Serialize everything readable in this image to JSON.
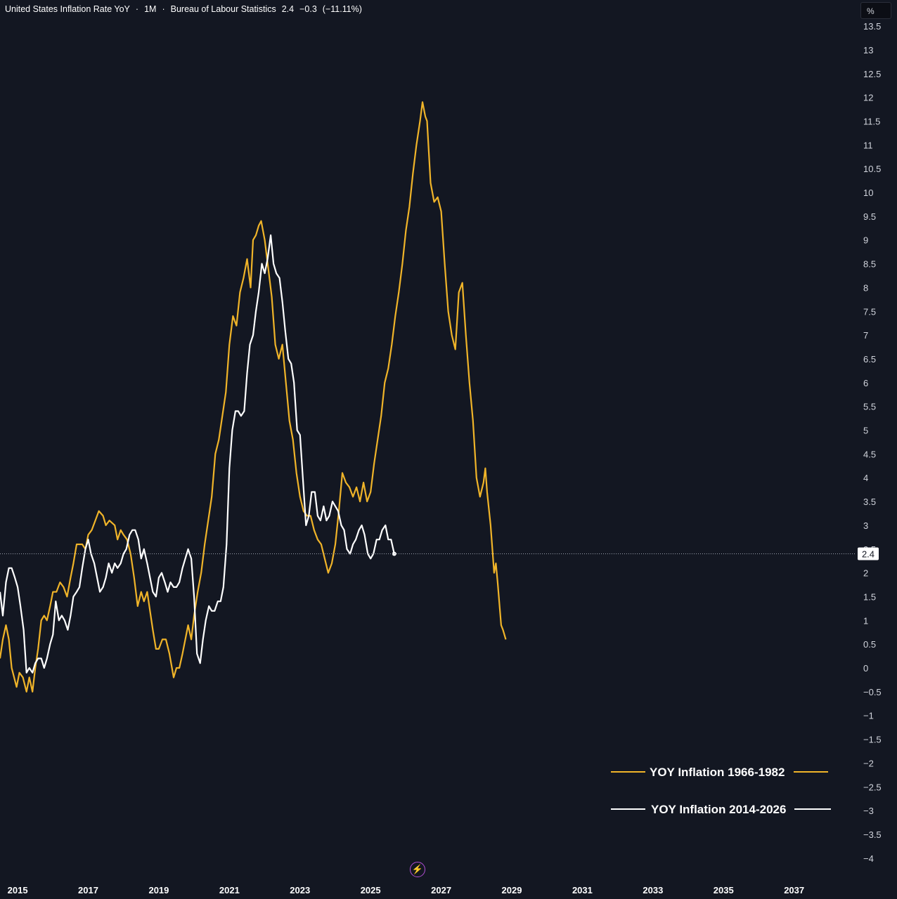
{
  "header": {
    "symbol_title": "United States Inflation Rate YoY",
    "interval": "1M",
    "source": "Bureau of Labour Statistics",
    "last_value": "2.4",
    "change": "−0.3",
    "change_percent": "(−11.11%)",
    "separator": "·"
  },
  "unit_label": "%",
  "icons": {
    "logo": "lightning-bolt-icon"
  },
  "colors": {
    "background": "#131722",
    "series_1966_1982": "#f0b429",
    "series_2014_2026": "#ffffff",
    "text": "#d1d4dc"
  },
  "chart_data": {
    "type": "line",
    "title": "United States Inflation Rate YoY",
    "xlabel": "",
    "ylabel": "%",
    "xlim": [
      2014.5,
      2038.6
    ],
    "ylim": [
      -4.2,
      13.8
    ],
    "x_ticks": [
      "2015",
      "2017",
      "2019",
      "2021",
      "2023",
      "2025",
      "2027",
      "2029",
      "2031",
      "2033",
      "2035",
      "2037"
    ],
    "y_ticks": [
      "13.5",
      "13",
      "12.5",
      "12",
      "11.5",
      "11",
      "10.5",
      "10",
      "9.5",
      "9",
      "8.5",
      "8",
      "7.5",
      "7",
      "6.5",
      "6",
      "5.5",
      "5",
      "4.5",
      "4",
      "3.5",
      "3",
      "2.5",
      "2",
      "1.5",
      "1",
      "0.5",
      "0",
      "−0.5",
      "−1",
      "−1.5",
      "−2",
      "−2.5",
      "−3",
      "−3.5",
      "−4"
    ],
    "current_value_label": "2.4",
    "current_value": 2.4,
    "grid": false,
    "legend_position": "bottom-right",
    "series": [
      {
        "name": "YOY Inflation 1966-1982",
        "points": [
          [
            2014.5,
            0.2
          ],
          [
            2014.58,
            0.6
          ],
          [
            2014.67,
            0.9
          ],
          [
            2014.75,
            0.6
          ],
          [
            2014.83,
            0.0
          ],
          [
            2014.9,
            -0.2
          ],
          [
            2014.97,
            -0.4
          ],
          [
            2015.05,
            -0.1
          ],
          [
            2015.15,
            -0.2
          ],
          [
            2015.25,
            -0.5
          ],
          [
            2015.33,
            -0.2
          ],
          [
            2015.42,
            -0.5
          ],
          [
            2015.5,
            0.0
          ],
          [
            2015.58,
            0.4
          ],
          [
            2015.67,
            1.0
          ],
          [
            2015.75,
            1.1
          ],
          [
            2015.83,
            1.0
          ],
          [
            2015.92,
            1.3
          ],
          [
            2016.0,
            1.6
          ],
          [
            2016.1,
            1.6
          ],
          [
            2016.2,
            1.8
          ],
          [
            2016.3,
            1.7
          ],
          [
            2016.4,
            1.5
          ],
          [
            2016.5,
            1.9
          ],
          [
            2016.58,
            2.2
          ],
          [
            2016.67,
            2.6
          ],
          [
            2016.83,
            2.6
          ],
          [
            2016.92,
            2.5
          ],
          [
            2017.0,
            2.8
          ],
          [
            2017.1,
            2.9
          ],
          [
            2017.2,
            3.1
          ],
          [
            2017.3,
            3.3
          ],
          [
            2017.42,
            3.2
          ],
          [
            2017.5,
            3.0
          ],
          [
            2017.6,
            3.1
          ],
          [
            2017.75,
            3.0
          ],
          [
            2017.83,
            2.7
          ],
          [
            2017.92,
            2.9
          ],
          [
            2018.0,
            2.8
          ],
          [
            2018.1,
            2.7
          ],
          [
            2018.2,
            2.4
          ],
          [
            2018.3,
            1.9
          ],
          [
            2018.4,
            1.3
          ],
          [
            2018.5,
            1.6
          ],
          [
            2018.58,
            1.4
          ],
          [
            2018.67,
            1.6
          ],
          [
            2018.75,
            1.2
          ],
          [
            2018.83,
            0.8
          ],
          [
            2018.92,
            0.4
          ],
          [
            2019.0,
            0.4
          ],
          [
            2019.1,
            0.6
          ],
          [
            2019.2,
            0.6
          ],
          [
            2019.3,
            0.3
          ],
          [
            2019.42,
            -0.2
          ],
          [
            2019.5,
            0.0
          ],
          [
            2019.58,
            0.0
          ],
          [
            2019.67,
            0.3
          ],
          [
            2019.75,
            0.6
          ],
          [
            2019.83,
            0.9
          ],
          [
            2019.92,
            0.6
          ],
          [
            2020.0,
            1.1
          ],
          [
            2020.1,
            1.6
          ],
          [
            2020.2,
            2.0
          ],
          [
            2020.3,
            2.6
          ],
          [
            2020.4,
            3.1
          ],
          [
            2020.5,
            3.6
          ],
          [
            2020.6,
            4.5
          ],
          [
            2020.7,
            4.8
          ],
          [
            2020.8,
            5.3
          ],
          [
            2020.9,
            5.8
          ],
          [
            2021.0,
            6.8
          ],
          [
            2021.1,
            7.4
          ],
          [
            2021.2,
            7.2
          ],
          [
            2021.3,
            7.9
          ],
          [
            2021.4,
            8.2
          ],
          [
            2021.5,
            8.6
          ],
          [
            2021.6,
            8.0
          ],
          [
            2021.67,
            9.0
          ],
          [
            2021.75,
            9.1
          ],
          [
            2021.83,
            9.3
          ],
          [
            2021.9,
            9.4
          ],
          [
            2022.0,
            9.0
          ],
          [
            2022.1,
            8.4
          ],
          [
            2022.2,
            7.8
          ],
          [
            2022.3,
            6.8
          ],
          [
            2022.4,
            6.5
          ],
          [
            2022.5,
            6.8
          ],
          [
            2022.6,
            6.0
          ],
          [
            2022.7,
            5.2
          ],
          [
            2022.8,
            4.8
          ],
          [
            2022.9,
            4.1
          ],
          [
            2023.0,
            3.6
          ],
          [
            2023.1,
            3.3
          ],
          [
            2023.2,
            3.2
          ],
          [
            2023.3,
            3.2
          ],
          [
            2023.4,
            2.9
          ],
          [
            2023.5,
            2.7
          ],
          [
            2023.6,
            2.6
          ],
          [
            2023.7,
            2.3
          ],
          [
            2023.8,
            2.0
          ],
          [
            2023.9,
            2.2
          ],
          [
            2024.0,
            2.6
          ],
          [
            2024.1,
            3.3
          ],
          [
            2024.2,
            4.1
          ],
          [
            2024.3,
            3.9
          ],
          [
            2024.4,
            3.8
          ],
          [
            2024.5,
            3.6
          ],
          [
            2024.6,
            3.8
          ],
          [
            2024.7,
            3.5
          ],
          [
            2024.8,
            3.9
          ],
          [
            2024.9,
            3.5
          ],
          [
            2025.0,
            3.7
          ],
          [
            2025.1,
            4.3
          ],
          [
            2025.2,
            4.8
          ],
          [
            2025.3,
            5.3
          ],
          [
            2025.4,
            6.0
          ],
          [
            2025.5,
            6.3
          ],
          [
            2025.6,
            6.8
          ],
          [
            2025.7,
            7.4
          ],
          [
            2025.8,
            7.9
          ],
          [
            2025.9,
            8.5
          ],
          [
            2026.0,
            9.2
          ],
          [
            2026.1,
            9.7
          ],
          [
            2026.2,
            10.4
          ],
          [
            2026.3,
            11.0
          ],
          [
            2026.4,
            11.5
          ],
          [
            2026.47,
            11.9
          ],
          [
            2026.55,
            11.6
          ],
          [
            2026.6,
            11.5
          ],
          [
            2026.7,
            10.2
          ],
          [
            2026.8,
            9.8
          ],
          [
            2026.9,
            9.9
          ],
          [
            2027.0,
            9.6
          ],
          [
            2027.1,
            8.5
          ],
          [
            2027.2,
            7.5
          ],
          [
            2027.3,
            7.0
          ],
          [
            2027.4,
            6.7
          ],
          [
            2027.5,
            7.9
          ],
          [
            2027.6,
            8.1
          ],
          [
            2027.7,
            7.0
          ],
          [
            2027.8,
            6.0
          ],
          [
            2027.9,
            5.2
          ],
          [
            2028.0,
            4.0
          ],
          [
            2028.1,
            3.6
          ],
          [
            2028.2,
            3.9
          ],
          [
            2028.25,
            4.2
          ],
          [
            2028.3,
            3.7
          ],
          [
            2028.4,
            3.0
          ],
          [
            2028.5,
            2.0
          ],
          [
            2028.55,
            2.2
          ],
          [
            2028.6,
            1.8
          ],
          [
            2028.7,
            0.9
          ],
          [
            2028.75,
            0.8
          ],
          [
            2028.83,
            0.6
          ]
        ]
      },
      {
        "name": "YOY Inflation 2014-2026",
        "points": [
          [
            2014.5,
            1.6
          ],
          [
            2014.58,
            1.1
          ],
          [
            2014.67,
            1.8
          ],
          [
            2014.75,
            2.1
          ],
          [
            2014.83,
            2.1
          ],
          [
            2014.92,
            1.9
          ],
          [
            2015.0,
            1.7
          ],
          [
            2015.08,
            1.3
          ],
          [
            2015.17,
            0.8
          ],
          [
            2015.25,
            -0.1
          ],
          [
            2015.33,
            0.0
          ],
          [
            2015.42,
            -0.1
          ],
          [
            2015.5,
            0.1
          ],
          [
            2015.58,
            0.2
          ],
          [
            2015.67,
            0.2
          ],
          [
            2015.75,
            0.0
          ],
          [
            2015.83,
            0.2
          ],
          [
            2015.92,
            0.5
          ],
          [
            2016.0,
            0.7
          ],
          [
            2016.08,
            1.4
          ],
          [
            2016.17,
            1.0
          ],
          [
            2016.25,
            1.1
          ],
          [
            2016.33,
            1.0
          ],
          [
            2016.42,
            0.8
          ],
          [
            2016.5,
            1.1
          ],
          [
            2016.58,
            1.5
          ],
          [
            2016.67,
            1.6
          ],
          [
            2016.75,
            1.7
          ],
          [
            2016.83,
            2.1
          ],
          [
            2016.92,
            2.5
          ],
          [
            2017.0,
            2.7
          ],
          [
            2017.08,
            2.4
          ],
          [
            2017.17,
            2.2
          ],
          [
            2017.25,
            1.9
          ],
          [
            2017.33,
            1.6
          ],
          [
            2017.42,
            1.7
          ],
          [
            2017.5,
            1.9
          ],
          [
            2017.58,
            2.2
          ],
          [
            2017.67,
            2.0
          ],
          [
            2017.75,
            2.2
          ],
          [
            2017.83,
            2.1
          ],
          [
            2017.92,
            2.2
          ],
          [
            2018.0,
            2.4
          ],
          [
            2018.08,
            2.5
          ],
          [
            2018.17,
            2.8
          ],
          [
            2018.25,
            2.9
          ],
          [
            2018.33,
            2.9
          ],
          [
            2018.42,
            2.7
          ],
          [
            2018.5,
            2.3
          ],
          [
            2018.58,
            2.5
          ],
          [
            2018.67,
            2.2
          ],
          [
            2018.75,
            1.9
          ],
          [
            2018.83,
            1.6
          ],
          [
            2018.92,
            1.5
          ],
          [
            2019.0,
            1.9
          ],
          [
            2019.08,
            2.0
          ],
          [
            2019.17,
            1.8
          ],
          [
            2019.25,
            1.6
          ],
          [
            2019.33,
            1.8
          ],
          [
            2019.42,
            1.7
          ],
          [
            2019.5,
            1.7
          ],
          [
            2019.58,
            1.8
          ],
          [
            2019.67,
            2.1
          ],
          [
            2019.75,
            2.3
          ],
          [
            2019.83,
            2.5
          ],
          [
            2019.92,
            2.3
          ],
          [
            2020.0,
            1.5
          ],
          [
            2020.08,
            0.3
          ],
          [
            2020.17,
            0.1
          ],
          [
            2020.25,
            0.6
          ],
          [
            2020.33,
            1.0
          ],
          [
            2020.42,
            1.3
          ],
          [
            2020.5,
            1.2
          ],
          [
            2020.58,
            1.2
          ],
          [
            2020.67,
            1.4
          ],
          [
            2020.75,
            1.4
          ],
          [
            2020.83,
            1.7
          ],
          [
            2020.92,
            2.6
          ],
          [
            2021.0,
            4.2
          ],
          [
            2021.08,
            5.0
          ],
          [
            2021.17,
            5.4
          ],
          [
            2021.25,
            5.4
          ],
          [
            2021.33,
            5.3
          ],
          [
            2021.42,
            5.4
          ],
          [
            2021.5,
            6.2
          ],
          [
            2021.58,
            6.8
          ],
          [
            2021.67,
            7.0
          ],
          [
            2021.75,
            7.5
          ],
          [
            2021.83,
            7.9
          ],
          [
            2021.92,
            8.5
          ],
          [
            2022.0,
            8.3
          ],
          [
            2022.08,
            8.6
          ],
          [
            2022.17,
            9.1
          ],
          [
            2022.25,
            8.5
          ],
          [
            2022.33,
            8.3
          ],
          [
            2022.42,
            8.2
          ],
          [
            2022.5,
            7.7
          ],
          [
            2022.58,
            7.1
          ],
          [
            2022.67,
            6.5
          ],
          [
            2022.75,
            6.4
          ],
          [
            2022.83,
            6.0
          ],
          [
            2022.92,
            5.0
          ],
          [
            2023.0,
            4.9
          ],
          [
            2023.08,
            4.0
          ],
          [
            2023.17,
            3.0
          ],
          [
            2023.25,
            3.2
          ],
          [
            2023.33,
            3.7
          ],
          [
            2023.42,
            3.7
          ],
          [
            2023.5,
            3.2
          ],
          [
            2023.58,
            3.1
          ],
          [
            2023.67,
            3.4
          ],
          [
            2023.75,
            3.1
          ],
          [
            2023.83,
            3.2
          ],
          [
            2023.92,
            3.5
          ],
          [
            2024.0,
            3.4
          ],
          [
            2024.08,
            3.3
          ],
          [
            2024.17,
            3.0
          ],
          [
            2024.25,
            2.9
          ],
          [
            2024.33,
            2.5
          ],
          [
            2024.42,
            2.4
          ],
          [
            2024.5,
            2.6
          ],
          [
            2024.58,
            2.7
          ],
          [
            2024.67,
            2.9
          ],
          [
            2024.75,
            3.0
          ],
          [
            2024.83,
            2.8
          ],
          [
            2024.92,
            2.4
          ],
          [
            2025.0,
            2.3
          ],
          [
            2025.08,
            2.4
          ],
          [
            2025.17,
            2.7
          ],
          [
            2025.25,
            2.7
          ],
          [
            2025.33,
            2.9
          ],
          [
            2025.42,
            3.0
          ],
          [
            2025.5,
            2.7
          ],
          [
            2025.58,
            2.7
          ],
          [
            2025.67,
            2.4
          ]
        ]
      }
    ]
  }
}
